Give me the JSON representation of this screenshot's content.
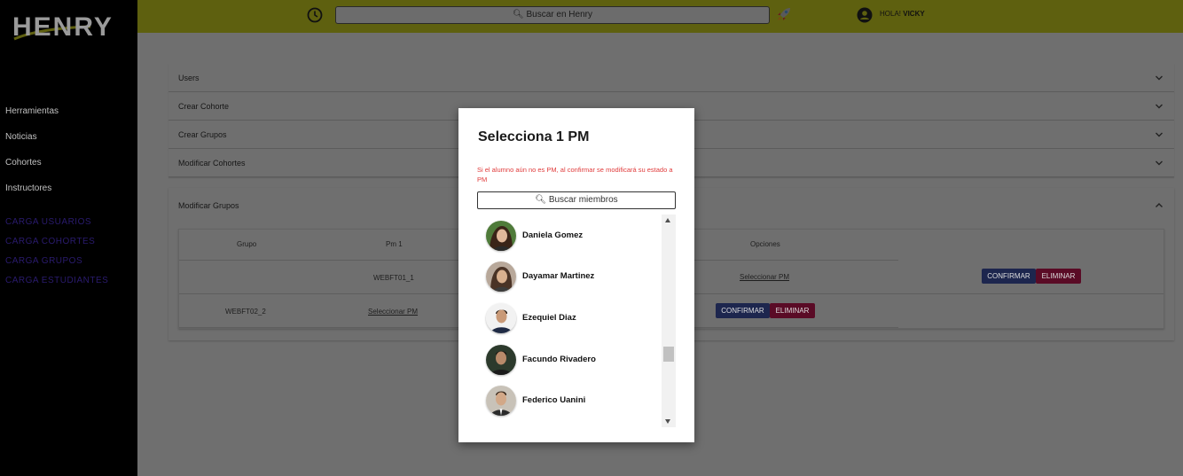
{
  "brand": {
    "logo_text": "HENRY"
  },
  "sidebar": {
    "items": [
      {
        "label": "Herramientas"
      },
      {
        "label": "Noticias"
      },
      {
        "label": "Cohortes"
      },
      {
        "label": "Instructores"
      }
    ],
    "carga": [
      {
        "label": "CARGA USUARIOS"
      },
      {
        "label": "CARGA COHORTES"
      },
      {
        "label": "CARGA GRUPOS"
      },
      {
        "label": "CARGA ESTUDIANTES"
      }
    ]
  },
  "topbar": {
    "search_placeholder": "Buscar en Henry",
    "greeting": "HOLA!",
    "username": "VICKY"
  },
  "accordion": [
    {
      "label": "Users"
    },
    {
      "label": "Crear Cohorte"
    },
    {
      "label": "Crear Grupos"
    },
    {
      "label": "Modificar Cohortes"
    },
    {
      "label": "Modificar Grupos"
    }
  ],
  "groups_table": {
    "headers": {
      "grupo": "Grupo",
      "pm1": "Pm 1",
      "opciones": "Opciones"
    },
    "rows": [
      {
        "grupo": "",
        "pm1": "WEBFT01_1",
        "opciones": "Seleccionar PM",
        "confirm": "CONFIRMAR",
        "delete": "ELIMINAR"
      },
      {
        "grupo": "WEBFT02_2",
        "pm1": "Seleccionar PM",
        "confirm": "CONFIRMAR",
        "delete": "ELIMINAR"
      }
    ]
  },
  "modal": {
    "title": "Selecciona 1 PM",
    "warning": "Si el alumno aún no es PM, al confirmar se modificará su estado a PM",
    "search_placeholder": "Buscar miembros",
    "members": [
      {
        "name": "Daniela Gomez"
      },
      {
        "name": "Dayamar Martinez"
      },
      {
        "name": "Ezequiel Diaz"
      },
      {
        "name": "Facundo Rivadero"
      },
      {
        "name": "Federico Uanini"
      }
    ]
  },
  "colors": {
    "topbar_yellow_dimmed": "#5e600f",
    "confirm_blue": "#1d264e",
    "delete_red": "#5a0b26",
    "warning_red": "#e03b3b"
  }
}
